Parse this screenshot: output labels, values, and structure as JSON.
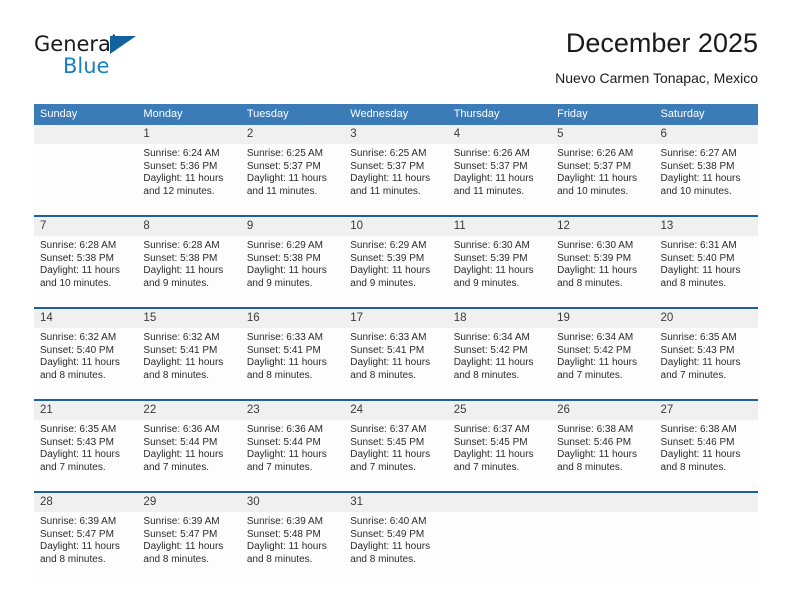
{
  "brand": {
    "name_part1": "General",
    "name_part2": "Blue",
    "accent_color": "#1a7fc1",
    "triangle_color": "#11639f"
  },
  "header": {
    "title": "December 2025",
    "subtitle": "Nuevo Carmen Tonapac, Mexico"
  },
  "calendar": {
    "header_bg": "#3b7cb8",
    "week_separator_color": "#1f5f9e",
    "daynum_bg": "#f0f0f0",
    "weekdays": [
      "Sunday",
      "Monday",
      "Tuesday",
      "Wednesday",
      "Thursday",
      "Friday",
      "Saturday"
    ],
    "weeks": [
      {
        "days": [
          {
            "num": "",
            "l1": "",
            "l2": "",
            "l3": "",
            "l4": ""
          },
          {
            "num": "1",
            "l1": "Sunrise: 6:24 AM",
            "l2": "Sunset: 5:36 PM",
            "l3": "Daylight: 11 hours",
            "l4": "and 12 minutes."
          },
          {
            "num": "2",
            "l1": "Sunrise: 6:25 AM",
            "l2": "Sunset: 5:37 PM",
            "l3": "Daylight: 11 hours",
            "l4": "and 11 minutes."
          },
          {
            "num": "3",
            "l1": "Sunrise: 6:25 AM",
            "l2": "Sunset: 5:37 PM",
            "l3": "Daylight: 11 hours",
            "l4": "and 11 minutes."
          },
          {
            "num": "4",
            "l1": "Sunrise: 6:26 AM",
            "l2": "Sunset: 5:37 PM",
            "l3": "Daylight: 11 hours",
            "l4": "and 11 minutes."
          },
          {
            "num": "5",
            "l1": "Sunrise: 6:26 AM",
            "l2": "Sunset: 5:37 PM",
            "l3": "Daylight: 11 hours",
            "l4": "and 10 minutes."
          },
          {
            "num": "6",
            "l1": "Sunrise: 6:27 AM",
            "l2": "Sunset: 5:38 PM",
            "l3": "Daylight: 11 hours",
            "l4": "and 10 minutes."
          }
        ]
      },
      {
        "days": [
          {
            "num": "7",
            "l1": "Sunrise: 6:28 AM",
            "l2": "Sunset: 5:38 PM",
            "l3": "Daylight: 11 hours",
            "l4": "and 10 minutes."
          },
          {
            "num": "8",
            "l1": "Sunrise: 6:28 AM",
            "l2": "Sunset: 5:38 PM",
            "l3": "Daylight: 11 hours",
            "l4": "and 9 minutes."
          },
          {
            "num": "9",
            "l1": "Sunrise: 6:29 AM",
            "l2": "Sunset: 5:38 PM",
            "l3": "Daylight: 11 hours",
            "l4": "and 9 minutes."
          },
          {
            "num": "10",
            "l1": "Sunrise: 6:29 AM",
            "l2": "Sunset: 5:39 PM",
            "l3": "Daylight: 11 hours",
            "l4": "and 9 minutes."
          },
          {
            "num": "11",
            "l1": "Sunrise: 6:30 AM",
            "l2": "Sunset: 5:39 PM",
            "l3": "Daylight: 11 hours",
            "l4": "and 9 minutes."
          },
          {
            "num": "12",
            "l1": "Sunrise: 6:30 AM",
            "l2": "Sunset: 5:39 PM",
            "l3": "Daylight: 11 hours",
            "l4": "and 8 minutes."
          },
          {
            "num": "13",
            "l1": "Sunrise: 6:31 AM",
            "l2": "Sunset: 5:40 PM",
            "l3": "Daylight: 11 hours",
            "l4": "and 8 minutes."
          }
        ]
      },
      {
        "days": [
          {
            "num": "14",
            "l1": "Sunrise: 6:32 AM",
            "l2": "Sunset: 5:40 PM",
            "l3": "Daylight: 11 hours",
            "l4": "and 8 minutes."
          },
          {
            "num": "15",
            "l1": "Sunrise: 6:32 AM",
            "l2": "Sunset: 5:41 PM",
            "l3": "Daylight: 11 hours",
            "l4": "and 8 minutes."
          },
          {
            "num": "16",
            "l1": "Sunrise: 6:33 AM",
            "l2": "Sunset: 5:41 PM",
            "l3": "Daylight: 11 hours",
            "l4": "and 8 minutes."
          },
          {
            "num": "17",
            "l1": "Sunrise: 6:33 AM",
            "l2": "Sunset: 5:41 PM",
            "l3": "Daylight: 11 hours",
            "l4": "and 8 minutes."
          },
          {
            "num": "18",
            "l1": "Sunrise: 6:34 AM",
            "l2": "Sunset: 5:42 PM",
            "l3": "Daylight: 11 hours",
            "l4": "and 8 minutes."
          },
          {
            "num": "19",
            "l1": "Sunrise: 6:34 AM",
            "l2": "Sunset: 5:42 PM",
            "l3": "Daylight: 11 hours",
            "l4": "and 7 minutes."
          },
          {
            "num": "20",
            "l1": "Sunrise: 6:35 AM",
            "l2": "Sunset: 5:43 PM",
            "l3": "Daylight: 11 hours",
            "l4": "and 7 minutes."
          }
        ]
      },
      {
        "days": [
          {
            "num": "21",
            "l1": "Sunrise: 6:35 AM",
            "l2": "Sunset: 5:43 PM",
            "l3": "Daylight: 11 hours",
            "l4": "and 7 minutes."
          },
          {
            "num": "22",
            "l1": "Sunrise: 6:36 AM",
            "l2": "Sunset: 5:44 PM",
            "l3": "Daylight: 11 hours",
            "l4": "and 7 minutes."
          },
          {
            "num": "23",
            "l1": "Sunrise: 6:36 AM",
            "l2": "Sunset: 5:44 PM",
            "l3": "Daylight: 11 hours",
            "l4": "and 7 minutes."
          },
          {
            "num": "24",
            "l1": "Sunrise: 6:37 AM",
            "l2": "Sunset: 5:45 PM",
            "l3": "Daylight: 11 hours",
            "l4": "and 7 minutes."
          },
          {
            "num": "25",
            "l1": "Sunrise: 6:37 AM",
            "l2": "Sunset: 5:45 PM",
            "l3": "Daylight: 11 hours",
            "l4": "and 7 minutes."
          },
          {
            "num": "26",
            "l1": "Sunrise: 6:38 AM",
            "l2": "Sunset: 5:46 PM",
            "l3": "Daylight: 11 hours",
            "l4": "and 8 minutes."
          },
          {
            "num": "27",
            "l1": "Sunrise: 6:38 AM",
            "l2": "Sunset: 5:46 PM",
            "l3": "Daylight: 11 hours",
            "l4": "and 8 minutes."
          }
        ]
      },
      {
        "days": [
          {
            "num": "28",
            "l1": "Sunrise: 6:39 AM",
            "l2": "Sunset: 5:47 PM",
            "l3": "Daylight: 11 hours",
            "l4": "and 8 minutes."
          },
          {
            "num": "29",
            "l1": "Sunrise: 6:39 AM",
            "l2": "Sunset: 5:47 PM",
            "l3": "Daylight: 11 hours",
            "l4": "and 8 minutes."
          },
          {
            "num": "30",
            "l1": "Sunrise: 6:39 AM",
            "l2": "Sunset: 5:48 PM",
            "l3": "Daylight: 11 hours",
            "l4": "and 8 minutes."
          },
          {
            "num": "31",
            "l1": "Sunrise: 6:40 AM",
            "l2": "Sunset: 5:49 PM",
            "l3": "Daylight: 11 hours",
            "l4": "and 8 minutes."
          },
          {
            "num": "",
            "l1": "",
            "l2": "",
            "l3": "",
            "l4": ""
          },
          {
            "num": "",
            "l1": "",
            "l2": "",
            "l3": "",
            "l4": ""
          },
          {
            "num": "",
            "l1": "",
            "l2": "",
            "l3": "",
            "l4": ""
          }
        ]
      }
    ]
  }
}
